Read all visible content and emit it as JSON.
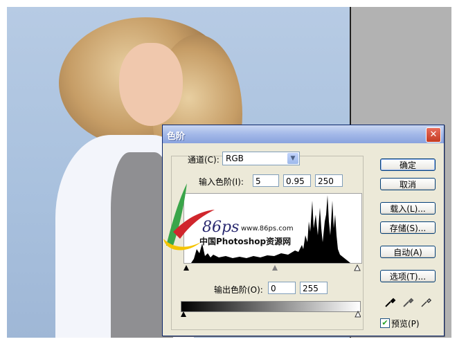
{
  "dialog": {
    "title": "色阶",
    "close_label": "✕",
    "channel_label": "通道(C):",
    "channel_value": "RGB",
    "input_levels_label": "输入色阶(I):",
    "input_black": "5",
    "input_gamma": "0.95",
    "input_white": "250",
    "output_levels_label": "输出色阶(O):",
    "output_black": "0",
    "output_white": "255",
    "buttons": {
      "ok": "确定",
      "cancel": "取消",
      "load": "载入(L)...",
      "save": "存储(S)...",
      "auto": "自动(A)",
      "options": "选项(T)..."
    },
    "preview_label": "预览(P)",
    "preview_checked": true
  },
  "watermark": {
    "logo_text": "86ps",
    "url": "www.86ps.com",
    "tagline": "中国Photoshop资源网"
  },
  "colors": {
    "titlebar": "#a3b8e8",
    "dialog_bg": "#ece9d8",
    "canvas_bg": "#b7cbe4",
    "gray_area": "#b2b2b2"
  }
}
